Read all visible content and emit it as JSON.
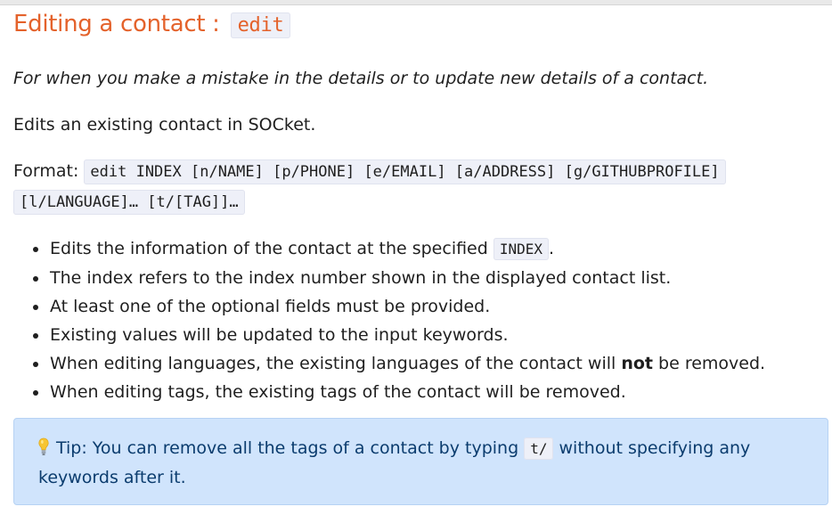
{
  "heading": {
    "text": "Editing a contact : ",
    "command": "edit"
  },
  "intro": "For when you make a mistake in the details or to update new details of a contact.",
  "description": "Edits an existing contact in SOCket.",
  "format": {
    "label": "Format: ",
    "line1": "edit INDEX [n/NAME] [p/PHONE] [e/EMAIL] [a/ADDRESS] [g/GITHUBPROFILE]",
    "line2": "[l/LANGUAGE]… [t/[TAG]]…"
  },
  "bullets": {
    "b1_pre": "Edits the information of the contact at the specified ",
    "b1_code": "INDEX",
    "b1_post": ".",
    "b2": "The index refers to the index number shown in the displayed contact list.",
    "b3": "At least one of the optional fields must be provided.",
    "b4": "Existing values will be updated to the input keywords.",
    "b5_pre": "When editing languages, the existing languages of the contact will ",
    "b5_bold": "not",
    "b5_post": " be removed.",
    "b6": "When editing tags, the existing tags of the contact will be removed."
  },
  "tip": {
    "icon": "lightbulb-icon",
    "pre": "Tip: You can remove all the tags of a contact by typing ",
    "code": "t/",
    "post": " without specifying any keywords after it."
  },
  "colors": {
    "heading": "#e4622b",
    "code_bg": "#eef0f8",
    "tip_bg": "#d0e4fc",
    "tip_text": "#0b3c6e"
  }
}
